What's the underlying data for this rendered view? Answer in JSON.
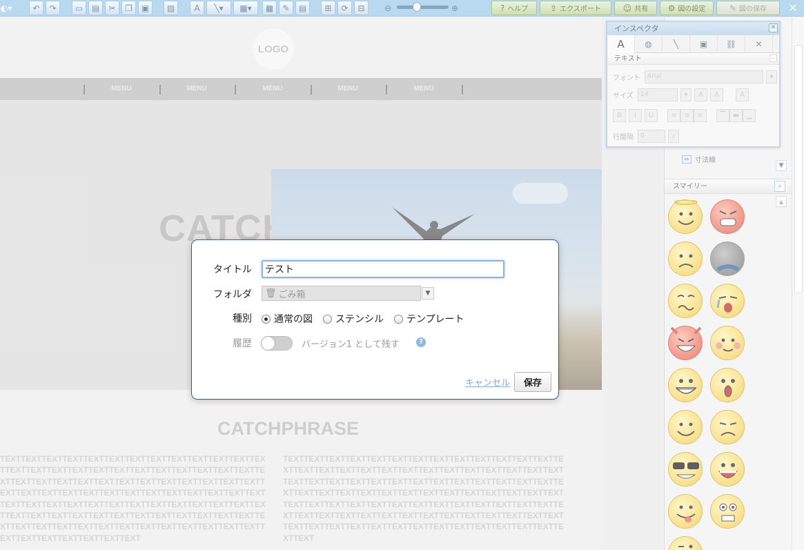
{
  "toolbar": {
    "help_label": "ヘルプ",
    "export_label": "エクスポート",
    "share_label": "共有",
    "settings_label": "図の設定",
    "save_label": "図の保存"
  },
  "canvas": {
    "logo": "LOGO",
    "menu_items": [
      "MENU",
      "MENU",
      "MENU",
      "MENU",
      "MENU"
    ],
    "hero_catch": "CATCHPHRASE",
    "catchphrase": "CATCHPHRASE",
    "text_left": "TEXTTEXTTEXTTEXTTEXTTEXTTEXTTEXTTEXTTEXTTEXTTEXTTEXTTEXTTEXTTEXTTEXTTEXTTEXTTEXTTEXTTEXTTEXTTEXTTEXTTEXTTEXTTEXTTEXTTEXTTEXTTEXTTEXTTEXTTEXTTEXTTEXTTEXTTEXTTEXTTEXTTEXTTEXTTEXTTEXTTEXTTEXTTEXTTEXTTEXTTEXTTEXTTEXTTEXTTEXTTEXTTEXTTEXTTEXTTEXTTEXTTEXTTEXTTEXTTEXTTEXTTEXTTEXTTEXTTEXTTEXTTEXTTEXTTEXTTEXTTEXTTEXTTEXTTEXTTEXTTEXTTEXTTEXTTEXTTEXTTEXTTEXTTEXTTEXTTEXTTEXTTEXTTEXTTEXTTEXTTEXT",
    "text_right": "TEXTTEXTTEXTTEXTTEXTTEXTTEXTTEXTTEXTTEXTTEXTTEXTTEXTTEXTTEXTTEXTTEXTTEXTTEXTTEXTTEXTTEXTTEXTTEXTTEXTTEXTTEXTTEXTTEXTTEXTTEXTTEXTTEXTTEXTTEXTTEXTTEXTTEXTTEXTTEXTTEXTTEXTTEXTTEXTTEXTTEXTTEXTTEXTTEXTTEXTTEXTTEXTTEXTTEXTTEXTTEXTTEXTTEXTTEXTTEXTTEXTTEXTTEXTTEXTTEXTTEXTTEXTTEXTTEXTTEXTTEXTTEXTTEXTTEXTTEXTTEXTTEXTTEXTTEXTTEXTTEXTTEXTTEXTTEXTTEXTTEXTTEXTTEXTTEXTTEXTTEXTTEXTTEXTTEXTTEXTTEXT"
  },
  "inspector": {
    "title": "インスペクタ",
    "section": "テキスト",
    "font_label": "フォント",
    "font_value": "Arial",
    "size_label": "サイズ",
    "size_value": "14",
    "line_spacing_label": "行間隔",
    "line_spacing_value": "0"
  },
  "stencil": {
    "tree_item": "寸法線",
    "section": "スマイリー"
  },
  "dialog": {
    "title_label": "タイトル",
    "title_value": "テスト",
    "folder_label": "フォルダ",
    "folder_value": "ごみ箱",
    "type_label": "種別",
    "types": [
      "通常の図",
      "ステンシル",
      "テンプレート"
    ],
    "history_label": "履歴",
    "history_text": "バージョン1 として残す",
    "help_glyph": "?",
    "cancel_label": "キャンセル",
    "save_label": "保存"
  }
}
